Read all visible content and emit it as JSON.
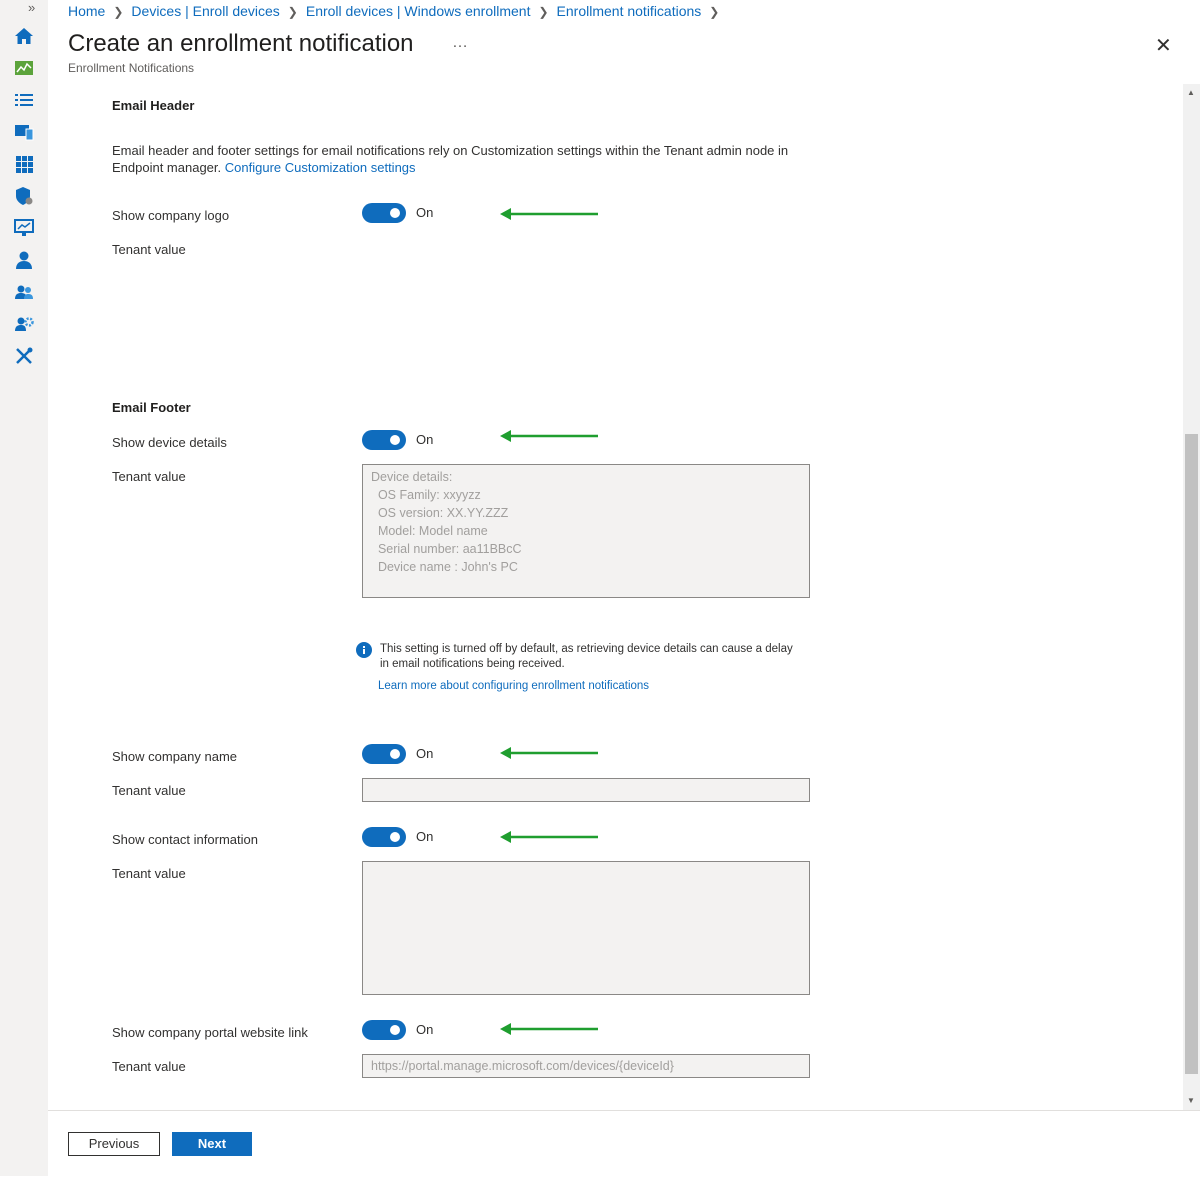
{
  "breadcrumb": [
    "Home",
    "Devices | Enroll devices",
    "Enroll devices | Windows enrollment",
    "Enrollment notifications"
  ],
  "page": {
    "title": "Create an enrollment notification",
    "more": "…",
    "subtitle": "Enrollment Notifications",
    "close": "✕"
  },
  "leftnav": {
    "expand": "»",
    "icons": [
      "home-icon",
      "dashboard-icon",
      "all-services-icon",
      "devices-icon",
      "apps-icon",
      "endpoint-security-icon",
      "reports-icon",
      "users-icon",
      "groups-icon",
      "tenant-admin-icon",
      "troubleshooting-icon"
    ]
  },
  "email_header": {
    "heading": "Email Header",
    "description": "Email header and footer settings for email notifications rely on Customization settings within the Tenant admin node in Endpoint manager.",
    "config_link": "Configure Customization settings",
    "show_logo": {
      "label": "Show company logo",
      "state": "On",
      "on": true
    },
    "tenant_value_label": "Tenant value"
  },
  "email_footer": {
    "heading": "Email Footer",
    "device_details": {
      "label": "Show device details",
      "state": "On",
      "on": true,
      "tenant_value_label": "Tenant value",
      "tenant_value": "Device details:\n  OS Family: xxyyzz\n  OS version: XX.YY.ZZZ\n  Model: Model name\n  Serial number: aa11BBcC\n  Device name : John's PC"
    },
    "info": {
      "text": "This setting is turned off by default, as retrieving device details can cause a delay in email notifications being received.",
      "link": "Learn more about configuring enrollment notifications"
    },
    "company_name": {
      "label": "Show company name",
      "state": "On",
      "on": true,
      "tenant_value_label": "Tenant value",
      "tenant_value": ""
    },
    "contact_info": {
      "label": "Show contact information",
      "state": "On",
      "on": true,
      "tenant_value_label": "Tenant value",
      "tenant_value": ""
    },
    "portal_link": {
      "label": "Show company portal website link",
      "state": "On",
      "on": true,
      "tenant_value_label": "Tenant value",
      "tenant_value": "https://portal.manage.microsoft.com/devices/{deviceId}"
    }
  },
  "footer": {
    "previous": "Previous",
    "next": "Next"
  },
  "colors": {
    "accent": "#0f6cbd",
    "annotation_arrow": "#1f9e2f"
  }
}
